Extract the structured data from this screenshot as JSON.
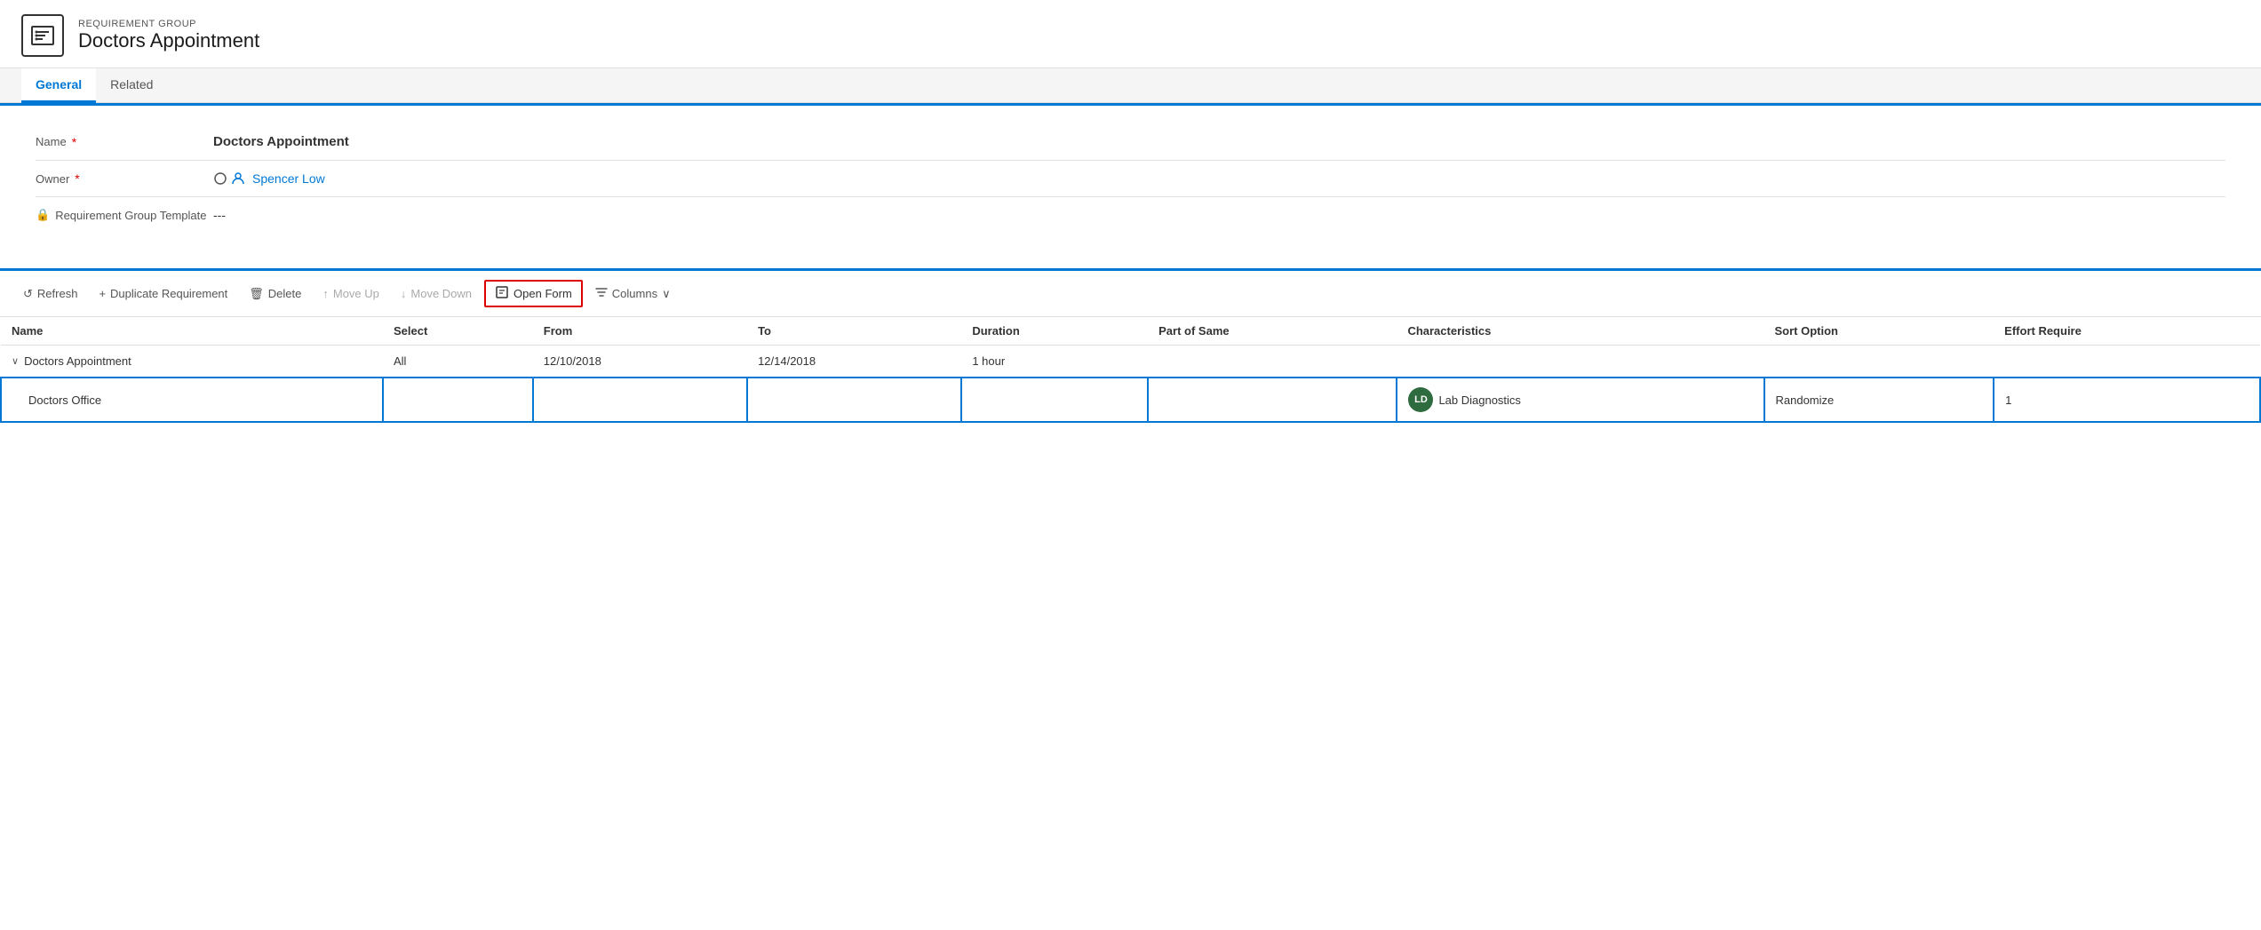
{
  "header": {
    "subtitle": "REQUIREMENT GROUP",
    "title": "Doctors Appointment"
  },
  "tabs": [
    {
      "label": "General",
      "active": true
    },
    {
      "label": "Related",
      "active": false
    }
  ],
  "form": {
    "fields": [
      {
        "label": "Name",
        "required": true,
        "value": "Doctors Appointment",
        "bold": true,
        "type": "text"
      },
      {
        "label": "Owner",
        "required": true,
        "value": "Spencer Low",
        "type": "owner"
      },
      {
        "label": "Requirement Group Template",
        "required": false,
        "value": "---",
        "type": "text",
        "has_lock": true
      }
    ]
  },
  "toolbar": {
    "buttons": [
      {
        "label": "Refresh",
        "icon": "↺",
        "disabled": false,
        "key": "refresh"
      },
      {
        "label": "Duplicate Requirement",
        "icon": "+",
        "disabled": false,
        "key": "duplicate"
      },
      {
        "label": "Delete",
        "icon": "🗑",
        "disabled": false,
        "key": "delete"
      },
      {
        "label": "Move Up",
        "icon": "↑",
        "disabled": true,
        "key": "move-up"
      },
      {
        "label": "Move Down",
        "icon": "↓",
        "disabled": true,
        "key": "move-down"
      },
      {
        "label": "Open Form",
        "icon": "📋",
        "disabled": false,
        "key": "open-form",
        "highlighted": true
      },
      {
        "label": "Columns",
        "icon": "▽",
        "disabled": false,
        "key": "columns"
      }
    ]
  },
  "table": {
    "columns": [
      "Name",
      "Select",
      "From",
      "To",
      "Duration",
      "Part of Same",
      "Characteristics",
      "Sort Option",
      "Effort Require"
    ],
    "rows": [
      {
        "type": "parent",
        "name": "Doctors Appointment",
        "select": "All",
        "from": "12/10/2018",
        "to": "12/14/2018",
        "duration": "1 hour",
        "part_of_same": "",
        "characteristics": "",
        "characteristics_badge": "",
        "characteristics_label": "",
        "sort_option": "",
        "effort_require": ""
      },
      {
        "type": "child",
        "name": "Doctors Office",
        "select": "",
        "from": "",
        "to": "",
        "duration": "",
        "part_of_same": "",
        "characteristics_badge": "LD",
        "characteristics_label": "Lab Diagnostics",
        "sort_option": "Randomize",
        "effort_require": "1",
        "selected": true
      }
    ]
  }
}
